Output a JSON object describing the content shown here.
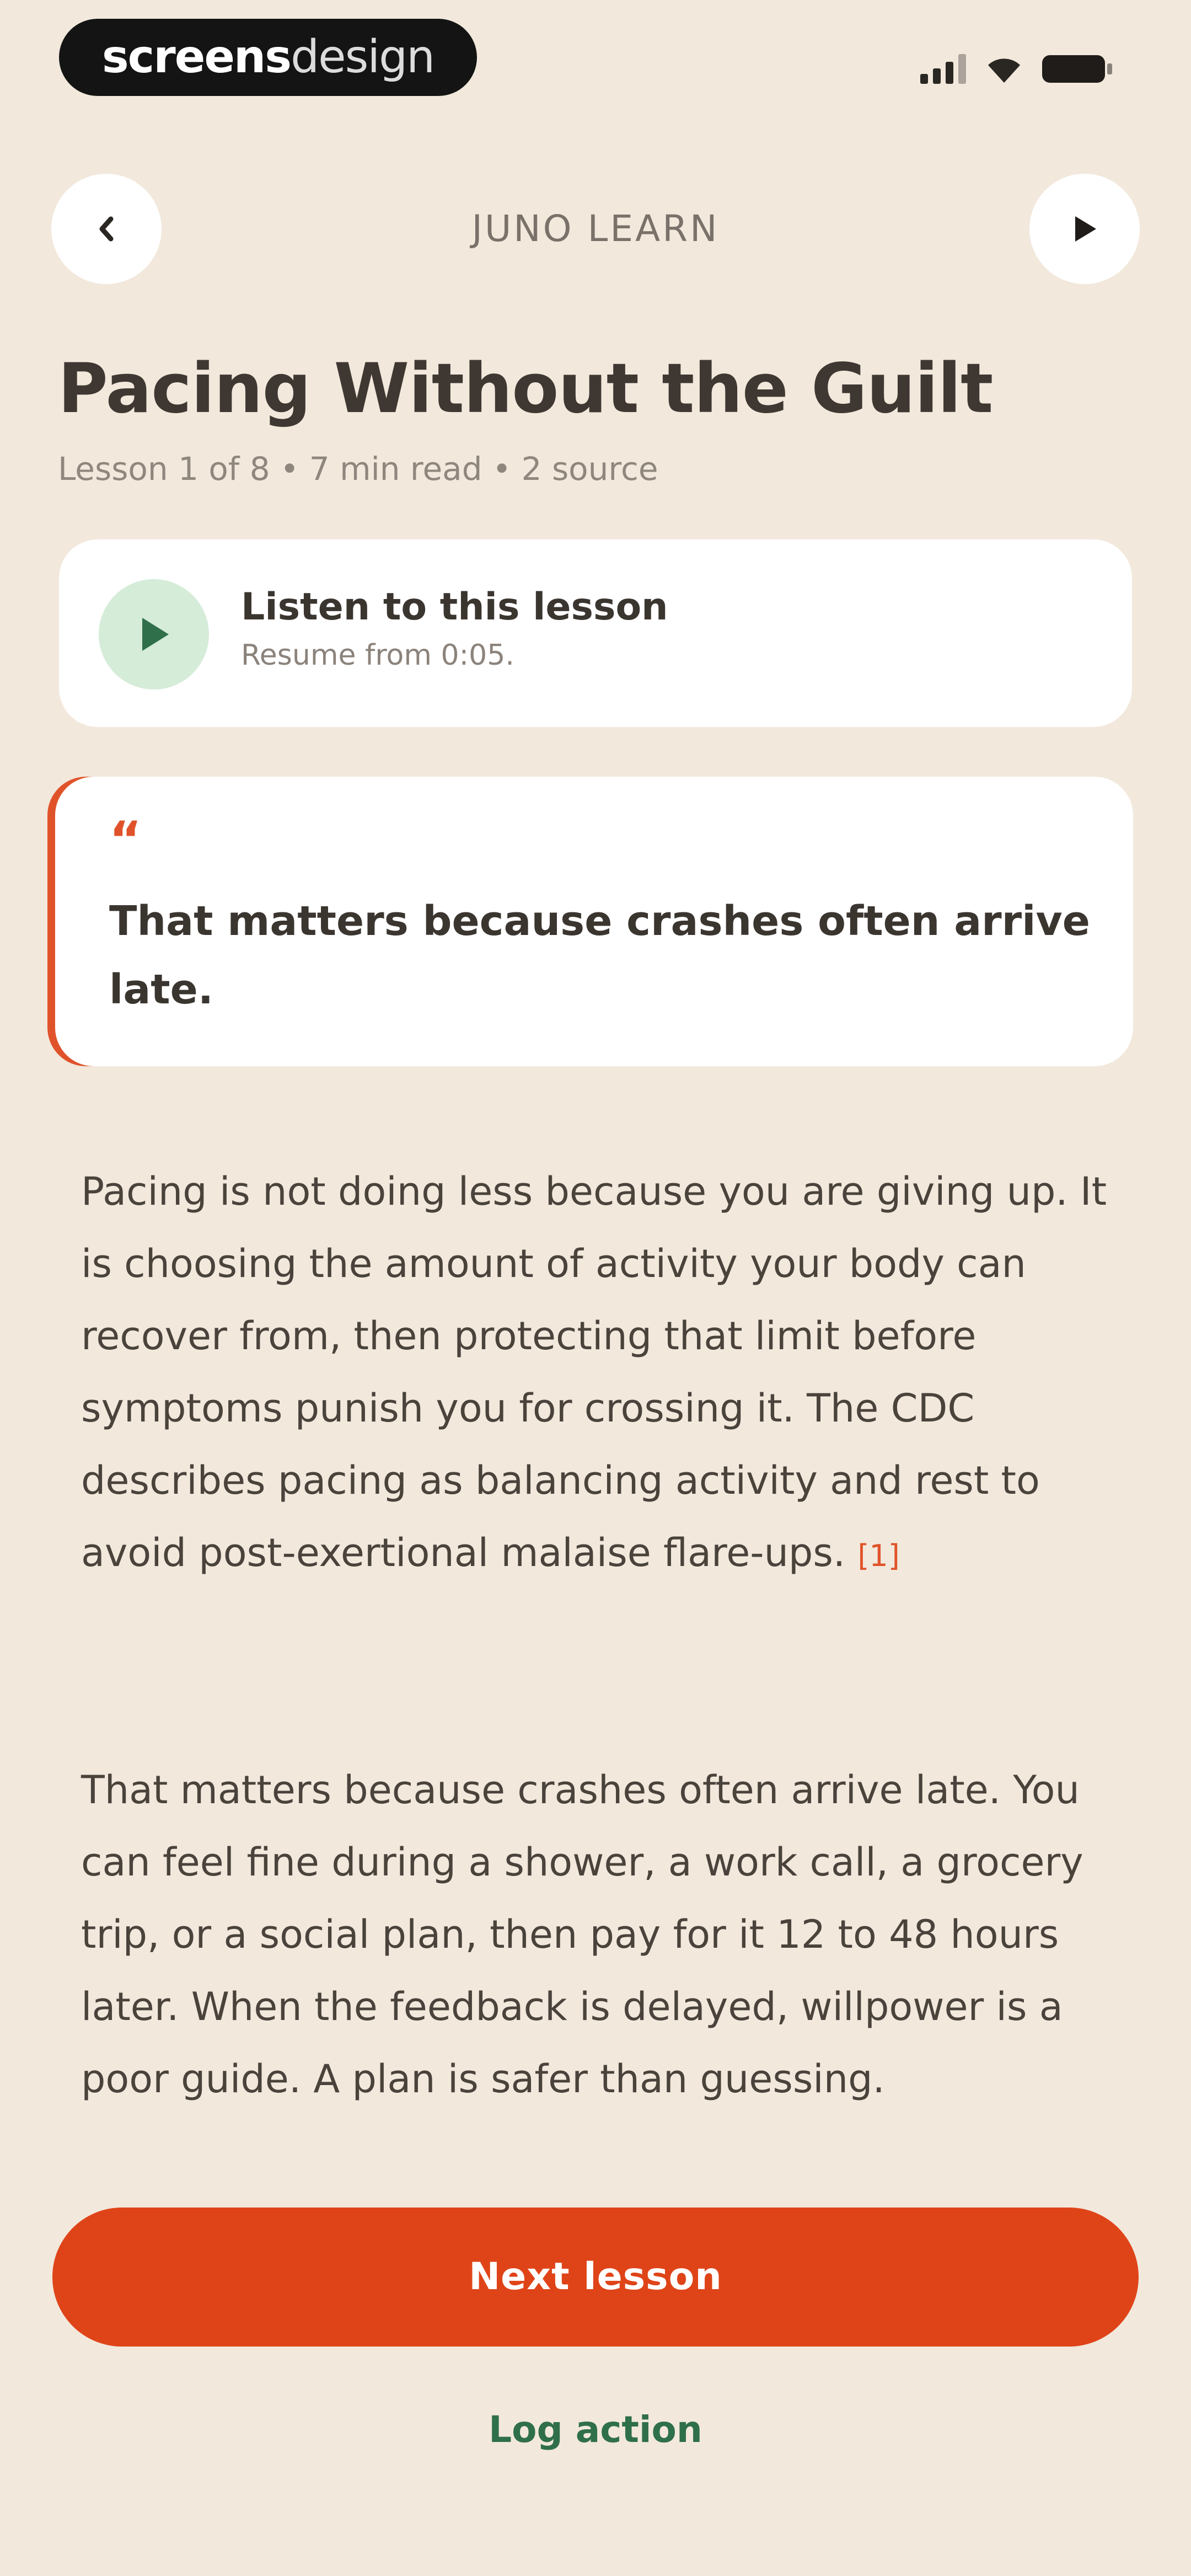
{
  "status_bar": {
    "brand_bold": "screens",
    "brand_light": "design",
    "icons": [
      "signal-icon",
      "wifi-icon",
      "battery-icon"
    ]
  },
  "header": {
    "title": "JUNO LEARN",
    "back_icon": "chevron-left-icon",
    "play_icon": "play-icon"
  },
  "lesson": {
    "title": "Pacing Without the Guilt",
    "meta": "Lesson 1 of 8 • 7 min read • 2 source"
  },
  "listen": {
    "title": "Listen to this lesson",
    "subtitle": "Resume from 0:05."
  },
  "quote": {
    "mark": "“",
    "text": "That matters because crashes often arrive late."
  },
  "body": {
    "paragraph_1": "Pacing is not doing less because you are giving up. It is choosing the amount of activity your body can recover from, then protecting that limit before symptoms punish you for crossing it. The CDC describes pacing as balancing activity and rest to avoid post-exertional malaise flare-ups.",
    "citation_1": "[1]",
    "paragraph_2": "That matters because crashes often arrive late. You can feel fine during a shower, a work call, a grocery trip, or a social plan, then pay for it 12 to 48 hours later. When the feedback is delayed, willpower is a poor guide. A plan is safer than guessing."
  },
  "actions": {
    "next_label": "Next lesson",
    "log_label": "Log action"
  },
  "colors": {
    "background": "#f2e8dc",
    "accent": "#df4418",
    "listen_play_bg": "#d5ecd9",
    "listen_play_icon": "#2f6f4a",
    "log_action": "#2f6f4a"
  }
}
